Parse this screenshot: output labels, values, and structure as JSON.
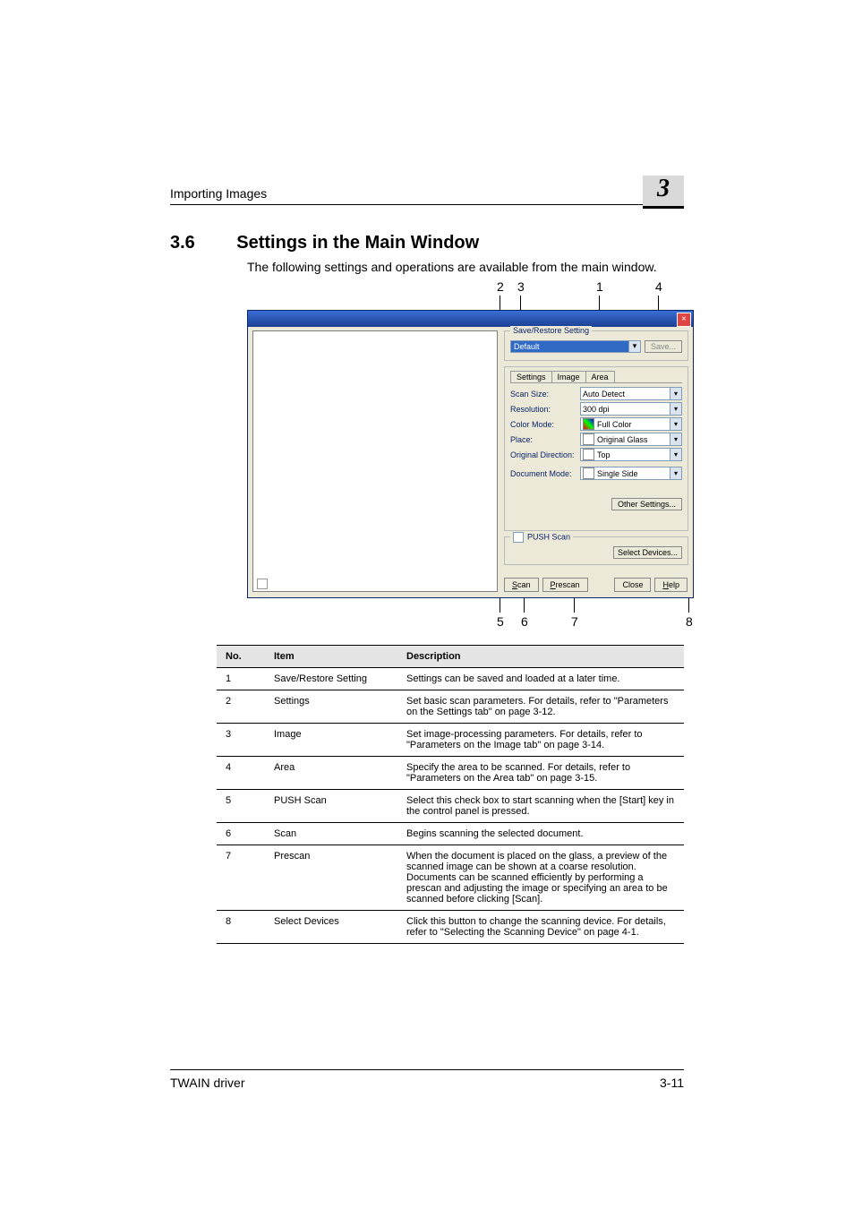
{
  "chapter_number": "3",
  "running_head": "Importing Images",
  "section_number": "3.6",
  "section_title": "Settings in the Main Window",
  "intro": "The following settings and operations are available from the main window.",
  "callout_labels": {
    "c1": "1",
    "c2": "2",
    "c3": "3",
    "c4": "4",
    "c5": "5",
    "c6": "6",
    "c7": "7",
    "c8": "8"
  },
  "screenshot": {
    "close_x": "×",
    "save_restore": {
      "legend": "Save/Restore Setting",
      "default_value": "Default",
      "save_btn": "Save..."
    },
    "tabs": {
      "settings": "Settings",
      "image": "Image",
      "area": "Area"
    },
    "fields": {
      "scan_size": {
        "label": "Scan Size:",
        "value": "Auto Detect"
      },
      "resolution": {
        "label": "Resolution:",
        "value": "300 dpi"
      },
      "color_mode": {
        "label": "Color Mode:",
        "value": "Full Color"
      },
      "place": {
        "label": "Place:",
        "value": "Original Glass"
      },
      "orig_dir": {
        "label": "Original Direction:",
        "value": "Top"
      },
      "doc_mode": {
        "label": "Document Mode:",
        "value": "Single Side"
      }
    },
    "other_settings": "Other Settings...",
    "push_legend": "PUSH Scan",
    "buttons": {
      "scan": "Scan",
      "prescan": "Prescan",
      "select_devices": "Select Devices...",
      "close": "Close",
      "help": "Help"
    }
  },
  "table": {
    "head_no": "No.",
    "head_item": "Item",
    "head_desc": "Description",
    "rows": [
      {
        "no": "1",
        "item": "Save/Restore Setting",
        "desc": "Settings can be saved and loaded at a later time."
      },
      {
        "no": "2",
        "item": "Settings",
        "desc": "Set basic scan parameters. For details, refer to \"Parameters on the Settings tab\" on page 3-12."
      },
      {
        "no": "3",
        "item": "Image",
        "desc": "Set image-processing parameters. For details, refer to \"Parameters on the Image tab\" on page 3-14."
      },
      {
        "no": "4",
        "item": "Area",
        "desc": "Specify the area to be scanned. For details, refer to \"Parameters on the Area tab\" on page 3-15."
      },
      {
        "no": "5",
        "item": "PUSH Scan",
        "desc": "Select this check box to start scanning when the [Start] key in the control panel is pressed."
      },
      {
        "no": "6",
        "item": "Scan",
        "desc": "Begins scanning the selected document."
      },
      {
        "no": "7",
        "item": "Prescan",
        "desc": "When the document is placed on the glass, a preview of the scanned image can be shown at a coarse resolution. Documents can be scanned efficiently by performing a prescan and adjusting the image or specifying an area to be scanned before clicking [Scan]."
      },
      {
        "no": "8",
        "item": "Select Devices",
        "desc": "Click this button to change the scanning device. For details, refer to \"Selecting the Scanning Device\" on page 4-1."
      }
    ]
  },
  "footer_left": "TWAIN driver",
  "footer_right": "3-11"
}
